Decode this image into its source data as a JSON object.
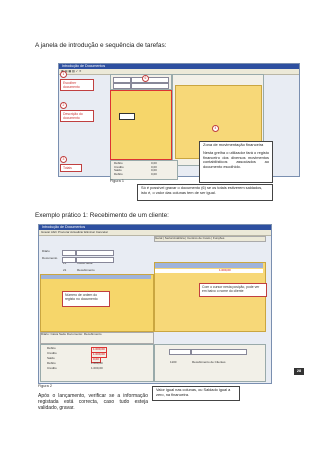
{
  "heading1": "A janela de introdução e sequência de tarefas:",
  "heading2": "Exemplo prático 1: Recebimento de um cliente:",
  "figure1": {
    "window_title": "Introdução de Documentos",
    "callouts": [
      {
        "number": "1",
        "label": "Escolher documento"
      },
      {
        "number": "2",
        "label": "Descrição do documento"
      },
      {
        "number": "3",
        "label": "Totais"
      }
    ],
    "badge4": "4",
    "zone_title": "Zona de movimentação financeira",
    "zone_text": "Nesta grelha o utilizador fará o registo financeiro dos diversos movimentos contabilísticos associados ao documento escolhido.",
    "save_note": "Só é possível gravar o documento (6) se os totais estiverem saldados, isto é, o valor das colunas tem de ser igual.",
    "badge6": "6",
    "totals_labels": [
      "Débito",
      "Crédito",
      "Saldo",
      "Débito",
      "Crédito"
    ],
    "totals_values": [
      "0,00",
      "0,00",
      "0,00",
      "0,00",
      "0,00"
    ],
    "caption": "Figura 1"
  },
  "figure2": {
    "window_title": "Introdução de Documentos",
    "toolbar": "Gravar  Abrir  Procurar  Actualizar  Eliminar  Cancelar",
    "tabs": [
      "Geral",
      "Serial Analítica",
      "Centros de Custo",
      "Funções"
    ],
    "diario_label": "Diário",
    "diario_value": "21",
    "diario_name": "Caixa Sede",
    "doc_label": "Documento",
    "doc_value": "21",
    "doc_name": "Recebimento",
    "row_value": "1.000,00",
    "callout_left": "Número de ordem do registo no documento",
    "callout_right": "Com o cursor nesta posição, pode ver em baixo o nome do cliente",
    "status_text": "Diário: Caixa Sede    Documento: Recebimento",
    "totals_labels": [
      "Débito",
      "Crédito",
      "Saldo",
      "Débito",
      "Crédito"
    ],
    "totals_values": [
      "1.000,00",
      "1.000,00",
      "0,00",
      "1.000,00",
      "1.000,00"
    ],
    "bottom_account": "1100",
    "bottom_name": "Recebimento de Clientes",
    "caption": "Figura 2",
    "note_balance": "Valor igual nas colunas, ou Saldado igual a zero, na financeira.",
    "body_text": "Após o lançamento, verificar se a informação registada está correcta, caso tudo esteja validado, gravar."
  },
  "page_number": "28"
}
